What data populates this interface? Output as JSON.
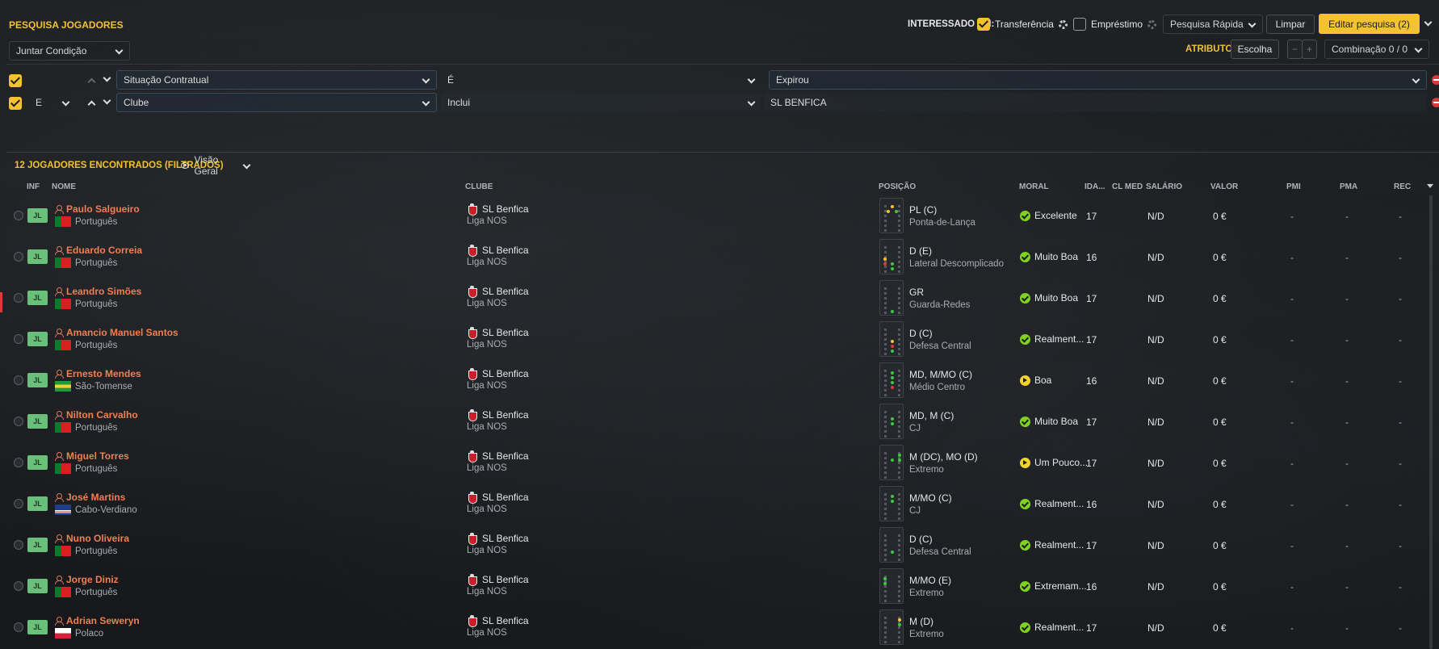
{
  "header": {
    "title": "PESQUISA JOGADORES",
    "join_condition": "Juntar Condição",
    "interested_label": "INTERESSADO EM:",
    "transfer_label": "Transferência",
    "loan_label": "Empréstimo",
    "quick_search": "Pesquisa Rápida",
    "clear": "Limpar",
    "edit_search": "Editar pesquisa (2)",
    "attributes_label": "ATRIBUTOS",
    "choice": "Escolha",
    "minus": "−",
    "plus": "+",
    "combination": "Combinação 0 / 0"
  },
  "filters": [
    {
      "join": "",
      "field": "Situação Contratual",
      "operator": "É",
      "value": "Expirou"
    },
    {
      "join": "E",
      "field": "Clube",
      "operator": "Inclui",
      "value": "SL BENFICA"
    }
  ],
  "results": {
    "count_label": "12 JOGADORES ENCONTRADOS (FILTRADOS)",
    "view": "Visão Geral"
  },
  "columns": {
    "inf": "INF",
    "name": "NOME",
    "club": "CLUBE",
    "position": "POSIÇÃO",
    "morale": "MORAL",
    "age": "IDA...",
    "cl_med": "CL MED",
    "salary": "SALÁRIO",
    "value": "VALOR",
    "pmi": "PMI",
    "pma": "PMA",
    "rec": "REC"
  },
  "colors": {
    "accent": "#f2c230",
    "name": "#f07f52",
    "mood_green": "#7ed321",
    "mood_yellow": "#f2d230"
  },
  "players": [
    {
      "name": "Paulo Salgueiro",
      "nat": "Português",
      "flag": "pt",
      "club": "SL Benfica",
      "league": "Liga NOS",
      "pos": "PL (C)",
      "role": "Ponta-de-Lança",
      "morale": "Excelente",
      "mood": "green",
      "age": "17",
      "salary": "N/D",
      "value": "0 €",
      "pmi": "-",
      "pma": "-",
      "rec": "-",
      "dots": [
        [
          13,
          8,
          "y"
        ],
        [
          8,
          14,
          "y"
        ],
        [
          18,
          14,
          "g"
        ]
      ]
    },
    {
      "name": "Eduardo Correia",
      "nat": "Português",
      "flag": "pt",
      "club": "SL Benfica",
      "league": "Liga NOS",
      "pos": "D (E)",
      "role": "Lateral Descomplicado",
      "morale": "Muito Boa",
      "mood": "green",
      "age": "16",
      "salary": "N/D",
      "value": "0 €",
      "pmi": "-",
      "pma": "-",
      "rec": "-",
      "dots": [
        [
          4,
          22,
          "y"
        ],
        [
          4,
          28,
          "r"
        ],
        [
          13,
          28,
          "g"
        ],
        [
          13,
          34,
          "g"
        ]
      ]
    },
    {
      "name": "Leandro Simões",
      "nat": "Português",
      "flag": "pt",
      "club": "SL Benfica",
      "league": "Liga NOS",
      "pos": "GR",
      "role": "Guarda-Redes",
      "morale": "Muito Boa",
      "mood": "green",
      "age": "17",
      "salary": "N/D",
      "value": "0 €",
      "pmi": "-",
      "pma": "-",
      "rec": "-",
      "dots": [
        [
          13,
          36,
          "g"
        ]
      ]
    },
    {
      "name": "Amancio Manuel Santos",
      "nat": "Português",
      "flag": "pt",
      "club": "SL Benfica",
      "league": "Liga NOS",
      "pos": "D (C)",
      "role": "Defesa Central",
      "morale": "Realment...",
      "mood": "green",
      "age": "17",
      "salary": "N/D",
      "value": "0 €",
      "pmi": "-",
      "pma": "-",
      "rec": "-",
      "dots": [
        [
          13,
          22,
          "y"
        ],
        [
          13,
          28,
          "r"
        ],
        [
          13,
          34,
          "g"
        ]
      ]
    },
    {
      "name": "Ernesto Mendes",
      "nat": "São-Tomense",
      "flag": "st",
      "club": "SL Benfica",
      "league": "Liga NOS",
      "pos": "MD, M/MO (C)",
      "role": "Médio Centro",
      "morale": "Boa",
      "mood": "yellow",
      "age": "16",
      "salary": "N/D",
      "value": "0 €",
      "pmi": "-",
      "pma": "-",
      "rec": "-",
      "dots": [
        [
          13,
          10,
          "g"
        ],
        [
          13,
          16,
          "g"
        ],
        [
          13,
          22,
          "g"
        ],
        [
          13,
          28,
          "r"
        ]
      ]
    },
    {
      "name": "Nilton Carvalho",
      "nat": "Português",
      "flag": "pt",
      "club": "SL Benfica",
      "league": "Liga NOS",
      "pos": "MD, M (C)",
      "role": "CJ",
      "morale": "Muito Boa",
      "mood": "green",
      "age": "17",
      "salary": "N/D",
      "value": "0 €",
      "pmi": "-",
      "pma": "-",
      "rec": "-",
      "dots": [
        [
          13,
          16,
          "g"
        ],
        [
          13,
          22,
          "g"
        ]
      ]
    },
    {
      "name": "Miguel Torres",
      "nat": "Português",
      "flag": "pt",
      "club": "SL Benfica",
      "league": "Liga NOS",
      "pos": "M (DC), MO (D)",
      "role": "Extremo",
      "morale": "Um Pouco...",
      "mood": "yellow",
      "age": "17",
      "salary": "N/D",
      "value": "0 €",
      "pmi": "-",
      "pma": "-",
      "rec": "-",
      "dots": [
        [
          22,
          10,
          "g"
        ],
        [
          13,
          16,
          "g"
        ],
        [
          22,
          16,
          "g"
        ]
      ]
    },
    {
      "name": "José Martins",
      "nat": "Cabo-Verdiano",
      "flag": "cv",
      "club": "SL Benfica",
      "league": "Liga NOS",
      "pos": "M/MO (C)",
      "role": "CJ",
      "morale": "Realment...",
      "mood": "green",
      "age": "16",
      "salary": "N/D",
      "value": "0 €",
      "pmi": "-",
      "pma": "-",
      "rec": "-",
      "dots": [
        [
          13,
          10,
          "g"
        ],
        [
          13,
          16,
          "g"
        ]
      ]
    },
    {
      "name": "Nuno Oliveira",
      "nat": "Português",
      "flag": "pt",
      "club": "SL Benfica",
      "league": "Liga NOS",
      "pos": "D (C)",
      "role": "Defesa Central",
      "morale": "Realment...",
      "mood": "green",
      "age": "17",
      "salary": "N/D",
      "value": "0 €",
      "pmi": "-",
      "pma": "-",
      "rec": "-",
      "dots": [
        [
          13,
          28,
          "g"
        ]
      ]
    },
    {
      "name": "Jorge Diniz",
      "nat": "Português",
      "flag": "pt",
      "club": "SL Benfica",
      "league": "Liga NOS",
      "pos": "M/MO (E)",
      "role": "Extremo",
      "morale": "Extremam...",
      "mood": "green",
      "age": "16",
      "salary": "N/D",
      "value": "0 €",
      "pmi": "-",
      "pma": "-",
      "rec": "-",
      "dots": [
        [
          4,
          10,
          "g"
        ],
        [
          4,
          16,
          "g"
        ]
      ]
    },
    {
      "name": "Adrian Seweryn",
      "nat": "Polaco",
      "flag": "pl",
      "club": "SL Benfica",
      "league": "Liga NOS",
      "pos": "M (D)",
      "role": "Extremo",
      "morale": "Realment...",
      "mood": "green",
      "age": "17",
      "salary": "N/D",
      "value": "0 €",
      "pmi": "-",
      "pma": "-",
      "rec": "-",
      "dots": [
        [
          22,
          10,
          "y"
        ],
        [
          22,
          16,
          "g"
        ]
      ]
    }
  ]
}
